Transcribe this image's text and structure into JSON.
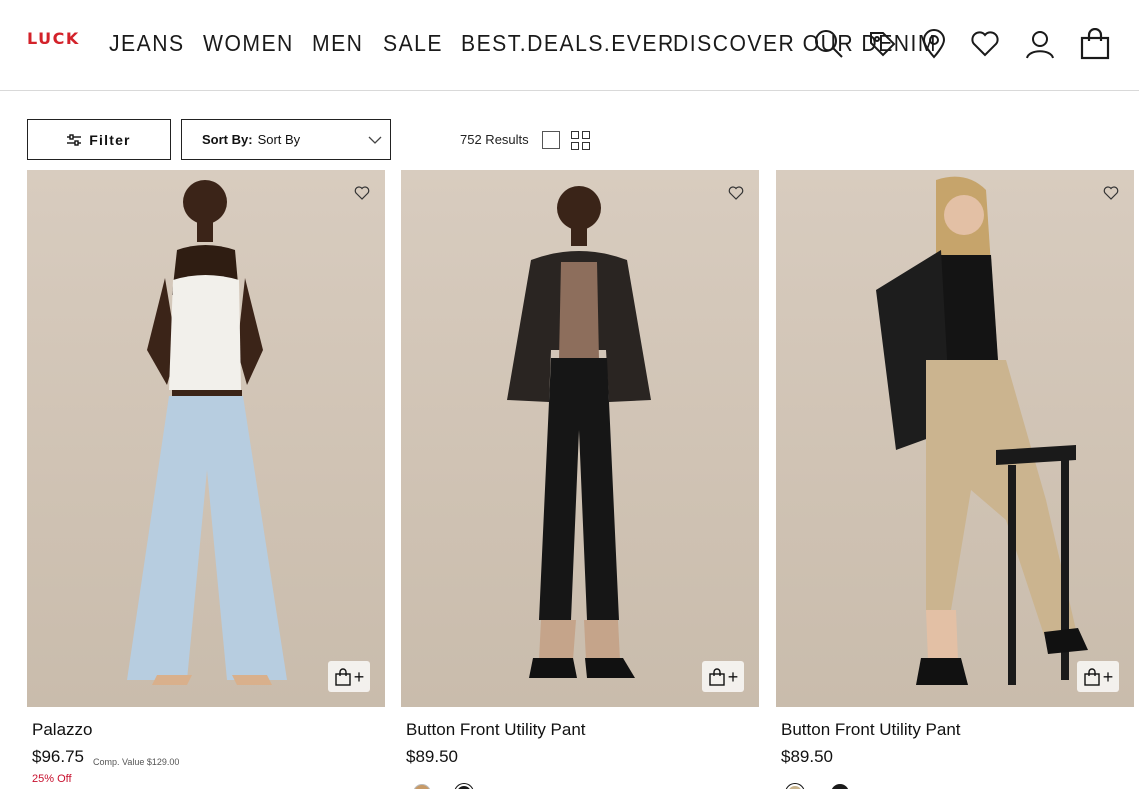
{
  "brand": {
    "logo": "LUCK",
    "accent": "#d3222a"
  },
  "nav": [
    "JEANS",
    "WOMEN",
    "MEN",
    "SALE",
    "BEST.DEALS.EVER",
    "DISCOVER OUR DENIM"
  ],
  "header_icons": [
    "search-icon",
    "tag-icon",
    "location-pin-icon",
    "heart-icon",
    "account-icon",
    "shopping-bag-icon"
  ],
  "toolbar": {
    "filter_label": "Filter",
    "sort_label": "Sort By:",
    "sort_value": "Sort By",
    "results": "752 Results"
  },
  "products": [
    {
      "name": "Palazzo",
      "price": "$96.75",
      "comp_value": "Comp. Value $129.00",
      "discount": "25% Off",
      "swatches": []
    },
    {
      "name": "Button Front Utility Pant",
      "price": "$89.50",
      "swatches": [
        "#c79a67",
        "#1a1a1a"
      ]
    },
    {
      "name": "Button Front Utility Pant",
      "price": "$89.50",
      "swatches": [
        "#c9b48d",
        "#1a1a1a"
      ]
    }
  ],
  "colors": {
    "discount": "#c8102e",
    "border": "#222222"
  }
}
